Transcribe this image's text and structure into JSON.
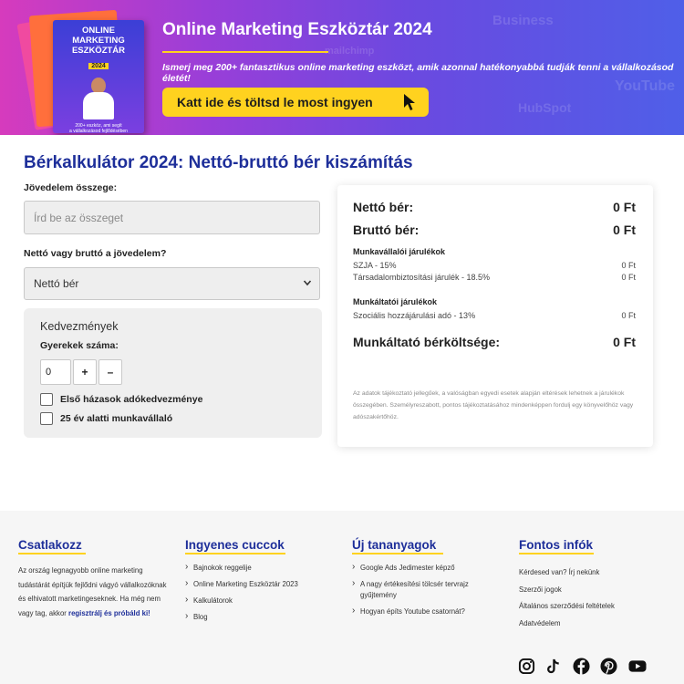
{
  "banner": {
    "ebook_title": "ONLINE\nMARKETING\nESZKÖZTÁR",
    "ebook_year": "2024",
    "ebook_subtitle": "200+ eszköz, ami segít\na vállalkozásod fejlődésében",
    "title": "Online Marketing Eszköztár 2024",
    "subtitle": "Ismerj meg 200+ fantasztikus online marketing eszközt, amik azonnal hatékonyabbá tudják tenni a vállalkozásod életét!",
    "cta_label": "Katt ide és töltsd le most ingyen",
    "background_logos": [
      "Business",
      "YouTube",
      "HubSpot",
      "mailchimp"
    ]
  },
  "page": {
    "title": "Bérkalkulátor 2024: Nettó-bruttó bér kiszámítás"
  },
  "form": {
    "income_label": "Jövedelem összege:",
    "income_placeholder": "Írd be az összeget",
    "income_value": "",
    "type_label": "Nettó vagy bruttó a jövedelem?",
    "type_selected": "Nettó bér",
    "benefits": {
      "title": "Kedvezmények",
      "kids_label": "Gyerekek száma:",
      "kids_value": "0",
      "plus_label": "+",
      "minus_label": "–",
      "first_marriage_label": "Első házasok adókedvezménye",
      "under25_label": "25 év alatti munkavállaló"
    }
  },
  "results": {
    "net_label": "Nettó bér:",
    "net_value": "0 Ft",
    "gross_label": "Bruttó bér:",
    "gross_value": "0 Ft",
    "employee_section": "Munkavállalói járulékok",
    "szja_label": "SZJA - 15%",
    "szja_value": "0 Ft",
    "tb_label": "Társadalombiztosítási járulék - 18.5%",
    "tb_value": "0 Ft",
    "employer_section": "Munkáltatói járulékok",
    "szocho_label": "Szociális hozzájárulási adó - 13%",
    "szocho_value": "0 Ft",
    "employer_cost_label": "Munkáltató bérköltsége:",
    "employer_cost_value": "0 Ft",
    "disclaimer": "Az adatok tájékoztató jellegűek, a valóságban egyedi esetek alapján eltérések lehetnek a járulékok összegében. Személyreszabott, pontos tájékoztatásához mindenképpen fordulj egy könyvelőhöz vagy adószakértőhöz."
  },
  "footer": {
    "col1": {
      "heading": "Csatlakozz",
      "text_before": "Az ország legnagyobb online marketing tudástárát építjük fejlődni vágyó vállalkozóknak és elhivatott marketingeseknek. Ha még nem vagy tag, akkor ",
      "link": "regisztrálj és próbáld ki!"
    },
    "col2": {
      "heading": "Ingyenes cuccok",
      "items": [
        "Bajnokok reggelije",
        "Online Marketing Eszköztár 2023",
        "Kalkulátorok",
        "Blog"
      ]
    },
    "col3": {
      "heading": "Új tananyagok",
      "items": [
        "Google Ads Jedimester képző",
        "A nagy értékesítési tölcsér tervrajz gyűjtemény",
        "Hogyan építs Youtube csatornát?"
      ]
    },
    "col4": {
      "heading": "Fontos infók",
      "items": [
        "Kérdesed van? Írj nekünk",
        "Szerzői jogok",
        "Általános szerződési feltételek",
        "Adatvédelem"
      ]
    },
    "social_icons": [
      "instagram-icon",
      "tiktok-icon",
      "facebook-icon",
      "pinterest-icon",
      "youtube-icon"
    ]
  },
  "colors": {
    "brand_blue": "#1e2f9a",
    "accent_yellow": "#ffd21f",
    "banner_gradient_start": "#d63bbd",
    "banner_gradient_end": "#4f5fe8"
  }
}
